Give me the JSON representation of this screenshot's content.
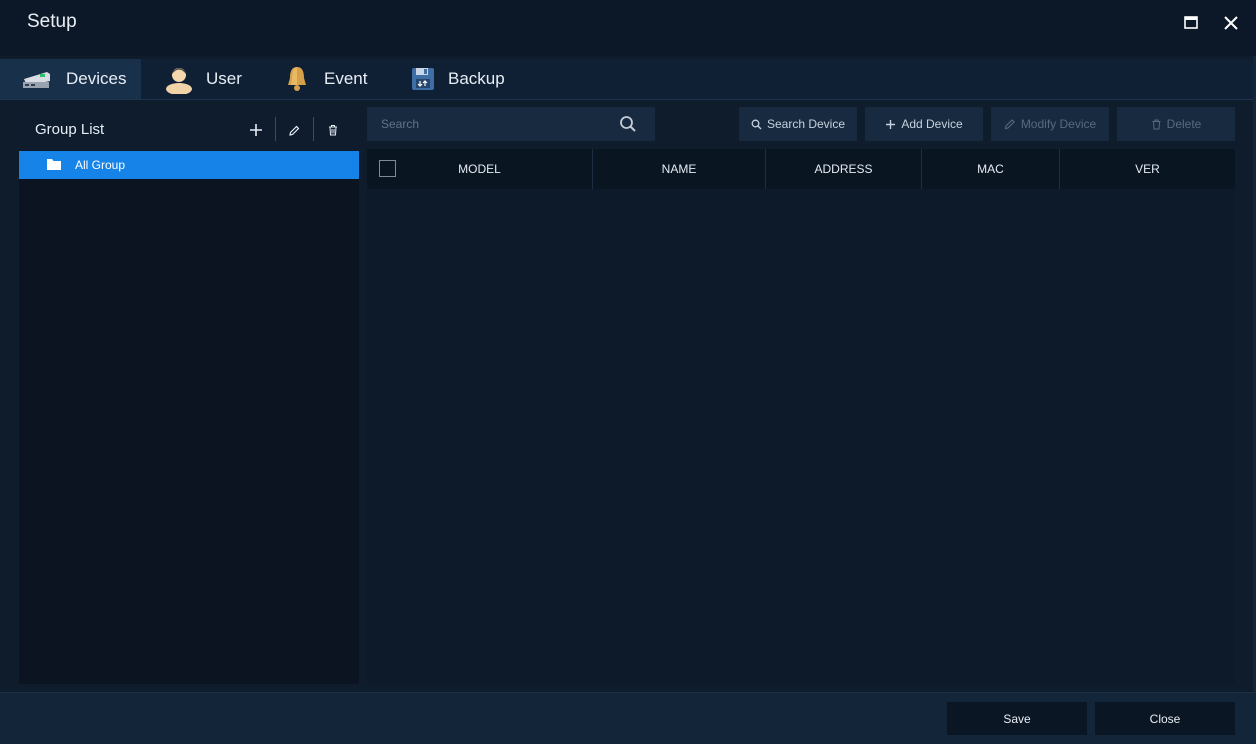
{
  "window": {
    "title": "Setup",
    "maximize_icon": "maximize-icon",
    "close_icon": "close-icon"
  },
  "tabs": [
    {
      "label": "Devices",
      "icon": "devices-icon",
      "active": true
    },
    {
      "label": "User",
      "icon": "user-icon",
      "active": false
    },
    {
      "label": "Event",
      "icon": "bell-icon",
      "active": false
    },
    {
      "label": "Backup",
      "icon": "floppy-disk-icon",
      "active": false
    }
  ],
  "group_list": {
    "title": "Group List",
    "add_icon": "plus-icon",
    "edit_icon": "pencil-icon",
    "delete_icon": "trash-icon",
    "items": [
      {
        "label": "All Group",
        "icon": "folder-icon",
        "selected": true
      }
    ]
  },
  "toolbar": {
    "search_placeholder": "Search",
    "search_device": "Search Device",
    "add_device": "Add Device",
    "modify_device": "Modify Device",
    "delete": "Delete"
  },
  "table": {
    "columns": [
      "MODEL",
      "NAME",
      "ADDRESS",
      "MAC",
      "VER"
    ],
    "rows": []
  },
  "footer": {
    "save": "Save",
    "close": "Close"
  },
  "colors": {
    "accent": "#1583e8",
    "background": "#0f1c2c",
    "panel": "#0b1420"
  }
}
